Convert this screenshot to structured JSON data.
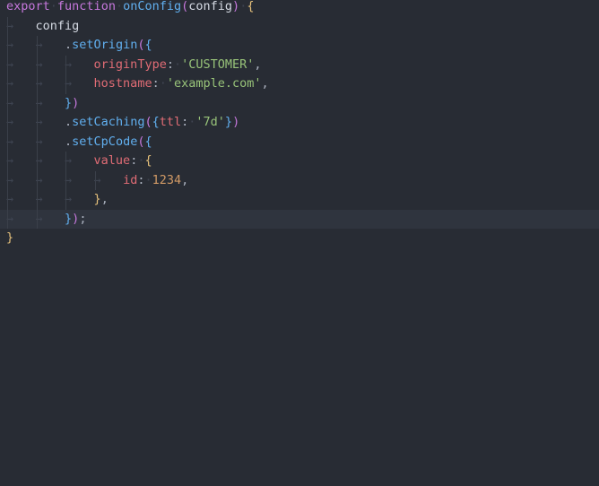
{
  "editor": {
    "lines": [
      [
        {
          "text": "export",
          "role": "keyword"
        },
        {
          "text": "·",
          "role": "ws"
        },
        {
          "text": "function",
          "role": "keyword"
        },
        {
          "text": "·",
          "role": "ws"
        },
        {
          "text": "onConfig",
          "role": "func"
        },
        {
          "text": "(",
          "role": "b2"
        },
        {
          "text": "config",
          "role": "plain"
        },
        {
          "text": ")",
          "role": "b2"
        },
        {
          "text": "·",
          "role": "ws"
        },
        {
          "text": "{",
          "role": "b1"
        }
      ],
      [
        {
          "text": "→   ",
          "role": "ws"
        },
        {
          "text": "config",
          "role": "plain"
        }
      ],
      [
        {
          "text": "→   ",
          "role": "ws"
        },
        {
          "text": "→   ",
          "role": "ws"
        },
        {
          "text": ".",
          "role": "punct"
        },
        {
          "text": "setOrigin",
          "role": "func"
        },
        {
          "text": "(",
          "role": "b2"
        },
        {
          "text": "{",
          "role": "b3"
        }
      ],
      [
        {
          "text": "→   ",
          "role": "ws"
        },
        {
          "text": "→   ",
          "role": "ws"
        },
        {
          "text": "→   ",
          "role": "ws"
        },
        {
          "text": "originType",
          "role": "prop"
        },
        {
          "text": ":",
          "role": "punct"
        },
        {
          "text": "·",
          "role": "ws"
        },
        {
          "text": "'CUSTOMER'",
          "role": "string"
        },
        {
          "text": ",",
          "role": "punct"
        }
      ],
      [
        {
          "text": "→   ",
          "role": "ws"
        },
        {
          "text": "→   ",
          "role": "ws"
        },
        {
          "text": "→   ",
          "role": "ws"
        },
        {
          "text": "hostname",
          "role": "prop"
        },
        {
          "text": ":",
          "role": "punct"
        },
        {
          "text": "·",
          "role": "ws"
        },
        {
          "text": "'example.com'",
          "role": "string"
        },
        {
          "text": ",",
          "role": "punct"
        }
      ],
      [
        {
          "text": "→   ",
          "role": "ws"
        },
        {
          "text": "→   ",
          "role": "ws"
        },
        {
          "text": "}",
          "role": "b3"
        },
        {
          "text": ")",
          "role": "b2"
        }
      ],
      [
        {
          "text": "→   ",
          "role": "ws"
        },
        {
          "text": "→   ",
          "role": "ws"
        },
        {
          "text": ".",
          "role": "punct"
        },
        {
          "text": "setCaching",
          "role": "func"
        },
        {
          "text": "(",
          "role": "b2"
        },
        {
          "text": "{",
          "role": "b3"
        },
        {
          "text": "ttl",
          "role": "prop"
        },
        {
          "text": ":",
          "role": "punct"
        },
        {
          "text": "·",
          "role": "ws"
        },
        {
          "text": "'7d'",
          "role": "string"
        },
        {
          "text": "}",
          "role": "b3"
        },
        {
          "text": ")",
          "role": "b2"
        }
      ],
      [
        {
          "text": "→   ",
          "role": "ws"
        },
        {
          "text": "→   ",
          "role": "ws"
        },
        {
          "text": ".",
          "role": "punct"
        },
        {
          "text": "setCpCode",
          "role": "func"
        },
        {
          "text": "(",
          "role": "b2"
        },
        {
          "text": "{",
          "role": "b3"
        }
      ],
      [
        {
          "text": "→   ",
          "role": "ws"
        },
        {
          "text": "→   ",
          "role": "ws"
        },
        {
          "text": "→   ",
          "role": "ws"
        },
        {
          "text": "value",
          "role": "prop"
        },
        {
          "text": ":",
          "role": "punct"
        },
        {
          "text": "·",
          "role": "ws"
        },
        {
          "text": "{",
          "role": "b1"
        }
      ],
      [
        {
          "text": "→   ",
          "role": "ws"
        },
        {
          "text": "→   ",
          "role": "ws"
        },
        {
          "text": "→   ",
          "role": "ws"
        },
        {
          "text": "→   ",
          "role": "ws"
        },
        {
          "text": "id",
          "role": "prop"
        },
        {
          "text": ":",
          "role": "punct"
        },
        {
          "text": "·",
          "role": "ws"
        },
        {
          "text": "1234",
          "role": "number"
        },
        {
          "text": ",",
          "role": "punct"
        }
      ],
      [
        {
          "text": "→   ",
          "role": "ws"
        },
        {
          "text": "→   ",
          "role": "ws"
        },
        {
          "text": "→   ",
          "role": "ws"
        },
        {
          "text": "}",
          "role": "b1"
        },
        {
          "text": ",",
          "role": "punct"
        }
      ],
      [
        {
          "text": "→   ",
          "role": "ws"
        },
        {
          "text": "→   ",
          "role": "ws"
        },
        {
          "text": "}",
          "role": "b3"
        },
        {
          "text": ")",
          "role": "b2"
        },
        {
          "text": ";",
          "role": "punct"
        }
      ],
      [
        {
          "text": "}",
          "role": "b1"
        }
      ]
    ],
    "current_line": 11,
    "colors": {
      "background": "#282c34",
      "current_line": "#2f343e",
      "keyword": "#c678dd",
      "function": "#61afef",
      "property": "#e06c75",
      "string": "#98c379",
      "number": "#d19a66",
      "bracket_gold": "#e5c07b",
      "bracket_purple": "#c678dd",
      "bracket_blue": "#61afef",
      "whitespace_marker": "#3e4451"
    }
  }
}
